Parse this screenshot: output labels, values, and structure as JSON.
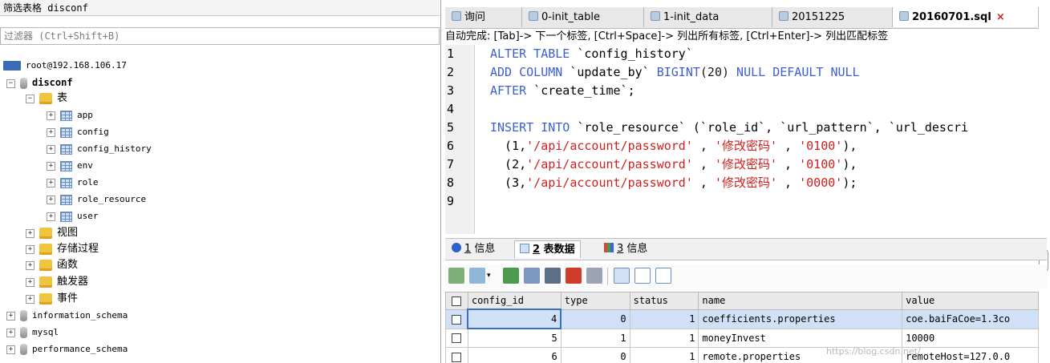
{
  "left_pane": {
    "title": "筛选表格 disconf",
    "filter_placeholder": "过滤器 (Ctrl+Shift+B)",
    "tree": {
      "server": "root@192.168.106.17",
      "db_disconf": "disconf",
      "folder_tables": "表",
      "tables": [
        "app",
        "config",
        "config_history",
        "env",
        "role",
        "role_resource",
        "user"
      ],
      "folders": [
        "视图",
        "存储过程",
        "函数",
        "触发器",
        "事件"
      ],
      "other_dbs": [
        "information_schema",
        "mysql",
        "performance_schema"
      ]
    }
  },
  "tabs": [
    {
      "label": "询问",
      "active": false
    },
    {
      "label": "0-init_table",
      "active": false
    },
    {
      "label": "1-init_data",
      "active": false
    },
    {
      "label": "20151225",
      "active": false
    },
    {
      "label": "20160701.sql",
      "active": true,
      "close": "×"
    }
  ],
  "autocomplete_hint": "自动完成: [Tab]-> 下一个标签, [Ctrl+Space]-> 列出所有标签, [Ctrl+Enter]-> 列出匹配标签",
  "editor": {
    "line_numbers": [
      "1",
      "2",
      "3",
      "4",
      "5",
      "6",
      "7",
      "8",
      "9"
    ],
    "lines": [
      {
        "kw1": "ALTER TABLE",
        "rest": " `config_history`"
      },
      {
        "kw1": "ADD COLUMN",
        "mid": " `update_by` ",
        "kw2": "BIGINT",
        "num": "(20)",
        "kw3": " NULL DEFAULT NULL"
      },
      {
        "kw1": "AFTER",
        "rest": " `create_time`;"
      },
      {},
      {
        "kw1": "INSERT INTO",
        "rest": " `role_resource` (`role_id`, `url_pattern`, `url_descri"
      },
      {
        "pre": "  (1,",
        "str": "'/api/account/password'",
        "mid": " , ",
        "str2": "'修改密码'",
        "mid2": " , ",
        "str3": "'0100'",
        "post": "),"
      },
      {
        "pre": "  (2,",
        "str": "'/api/account/password'",
        "mid": " , ",
        "str2": "'修改密码'",
        "mid2": " , ",
        "str3": "'0100'",
        "post": "),"
      },
      {
        "pre": "  (3,",
        "str": "'/api/account/password'",
        "mid": " , ",
        "str2": "'修改密码'",
        "mid2": " , ",
        "str3": "'0000'",
        "post": ");"
      },
      {}
    ]
  },
  "result_tabs": [
    {
      "num": "1",
      "label": " 信息",
      "active": false
    },
    {
      "num": "2",
      "label": " 表数据",
      "active": true
    },
    {
      "num": "3",
      "label": " 信息",
      "active": false
    }
  ],
  "grid": {
    "columns": [
      "config_id",
      "type",
      "status",
      "name",
      "value"
    ],
    "rows": [
      {
        "config_id": "4",
        "type": "0",
        "status": "1",
        "name": "coefficients.properties",
        "value": "coe.baiFaCoe=1.3co"
      },
      {
        "config_id": "5",
        "type": "1",
        "status": "1",
        "name": "moneyInvest",
        "value": "10000"
      },
      {
        "config_id": "6",
        "type": "0",
        "status": "1",
        "name": "remote.properties",
        "value": "remoteHost=127.0.0"
      }
    ]
  },
  "watermark": "https://blog.csdn.net/..."
}
